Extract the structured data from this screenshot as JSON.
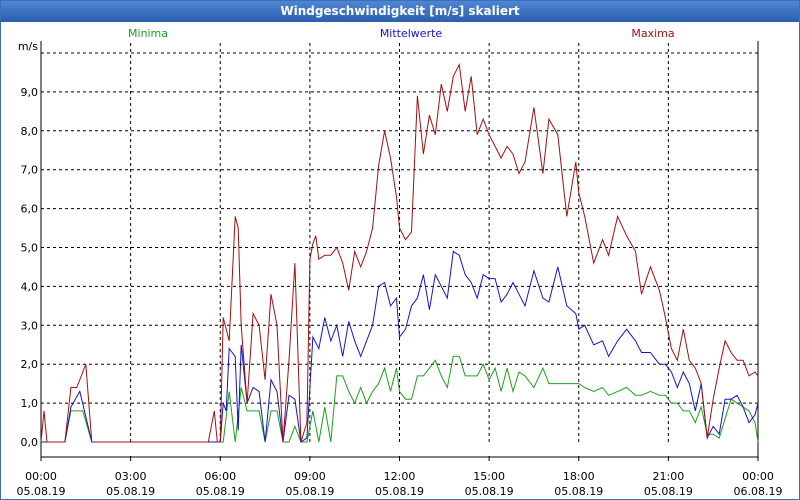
{
  "window_title": "Windgeschwindigkeit [m/s] skaliert",
  "colors": {
    "minima": "#1ca01c",
    "mittelwerte": "#1414c8",
    "maxima": "#a01010",
    "grid": "#000000"
  },
  "chart_data": {
    "type": "line",
    "title": "Windgeschwindigkeit [m/s] skaliert",
    "ylabel": "m/s",
    "ylim": [
      0,
      10
    ],
    "xlim_hours": [
      0,
      24
    ],
    "grid": true,
    "y_ticks": [
      "0,0",
      "1,0",
      "2,0",
      "3,0",
      "4,0",
      "5,0",
      "6,0",
      "7,0",
      "8,0",
      "9,0"
    ],
    "x_ticks": [
      {
        "time": "00:00",
        "date": "05.08.19"
      },
      {
        "time": "03:00",
        "date": "05.08.19"
      },
      {
        "time": "06:00",
        "date": "05.08.19"
      },
      {
        "time": "09:00",
        "date": "05.08.19"
      },
      {
        "time": "12:00",
        "date": "05.08.19"
      },
      {
        "time": "15:00",
        "date": "05.08.19"
      },
      {
        "time": "18:00",
        "date": "05.08.19"
      },
      {
        "time": "21:00",
        "date": "05.08.19"
      },
      {
        "time": "00:00",
        "date": "06.08.19"
      }
    ],
    "series": [
      {
        "name": "Minima",
        "color": "#1ca01c",
        "points": [
          [
            0,
            0
          ],
          [
            0.2,
            0
          ],
          [
            0.8,
            0
          ],
          [
            1.0,
            0.8
          ],
          [
            1.4,
            0.8
          ],
          [
            1.7,
            0
          ],
          [
            6.0,
            0
          ],
          [
            6.1,
            0
          ],
          [
            6.3,
            1.3
          ],
          [
            6.5,
            0
          ],
          [
            6.7,
            1.4
          ],
          [
            6.9,
            0.8
          ],
          [
            7.1,
            0.8
          ],
          [
            7.3,
            0.8
          ],
          [
            7.5,
            0
          ],
          [
            7.7,
            0.8
          ],
          [
            7.9,
            0.8
          ],
          [
            8.1,
            0
          ],
          [
            8.3,
            0
          ],
          [
            8.5,
            0.4
          ],
          [
            8.7,
            0
          ],
          [
            8.9,
            0
          ],
          [
            9.1,
            0.8
          ],
          [
            9.3,
            0
          ],
          [
            9.5,
            0.9
          ],
          [
            9.7,
            0
          ],
          [
            9.9,
            1.7
          ],
          [
            10.1,
            1.7
          ],
          [
            10.3,
            1.3
          ],
          [
            10.5,
            1.0
          ],
          [
            10.7,
            1.4
          ],
          [
            10.9,
            1.0
          ],
          [
            11.1,
            1.3
          ],
          [
            11.3,
            1.5
          ],
          [
            11.5,
            1.9
          ],
          [
            11.7,
            1.3
          ],
          [
            11.9,
            1.9
          ],
          [
            12.0,
            1.3
          ],
          [
            12.2,
            1.1
          ],
          [
            12.4,
            1.1
          ],
          [
            12.6,
            1.7
          ],
          [
            12.8,
            1.7
          ],
          [
            13.0,
            1.9
          ],
          [
            13.2,
            2.1
          ],
          [
            13.4,
            1.7
          ],
          [
            13.6,
            1.4
          ],
          [
            13.8,
            2.2
          ],
          [
            14.0,
            2.2
          ],
          [
            14.2,
            1.7
          ],
          [
            14.4,
            1.7
          ],
          [
            14.6,
            1.7
          ],
          [
            14.8,
            2.0
          ],
          [
            15.0,
            1.6
          ],
          [
            15.2,
            1.9
          ],
          [
            15.4,
            1.3
          ],
          [
            15.6,
            1.9
          ],
          [
            15.8,
            1.3
          ],
          [
            16.0,
            1.8
          ],
          [
            16.2,
            1.7
          ],
          [
            16.5,
            1.4
          ],
          [
            16.8,
            1.9
          ],
          [
            17.0,
            1.5
          ],
          [
            17.3,
            1.5
          ],
          [
            17.6,
            1.5
          ],
          [
            17.9,
            1.5
          ],
          [
            18.0,
            1.5
          ],
          [
            18.2,
            1.4
          ],
          [
            18.5,
            1.3
          ],
          [
            18.8,
            1.4
          ],
          [
            19.0,
            1.2
          ],
          [
            19.3,
            1.3
          ],
          [
            19.6,
            1.4
          ],
          [
            19.9,
            1.2
          ],
          [
            20.1,
            1.2
          ],
          [
            20.4,
            1.3
          ],
          [
            20.7,
            1.2
          ],
          [
            20.9,
            1.2
          ],
          [
            21.1,
            1.0
          ],
          [
            21.3,
            1.0
          ],
          [
            21.5,
            0.8
          ],
          [
            21.7,
            0.8
          ],
          [
            21.9,
            0.5
          ],
          [
            22.1,
            0.9
          ],
          [
            22.3,
            0.2
          ],
          [
            22.5,
            0.2
          ],
          [
            22.7,
            0.1
          ],
          [
            22.9,
            0.6
          ],
          [
            23.1,
            1.1
          ],
          [
            23.3,
            1.0
          ],
          [
            23.5,
            0.9
          ],
          [
            23.7,
            0.8
          ],
          [
            23.9,
            0.5
          ],
          [
            24.0,
            0
          ]
        ]
      },
      {
        "name": "Mittelwerte",
        "color": "#1414c8",
        "points": [
          [
            0,
            0
          ],
          [
            0.2,
            0
          ],
          [
            0.8,
            0
          ],
          [
            1.0,
            0.9
          ],
          [
            1.3,
            1.3
          ],
          [
            1.7,
            0
          ],
          [
            6.0,
            0
          ],
          [
            6.1,
            1.0
          ],
          [
            6.2,
            0.8
          ],
          [
            6.3,
            2.4
          ],
          [
            6.5,
            2.2
          ],
          [
            6.6,
            0.3
          ],
          [
            6.7,
            2.5
          ],
          [
            6.9,
            1.0
          ],
          [
            7.1,
            1.4
          ],
          [
            7.3,
            1.3
          ],
          [
            7.5,
            0
          ],
          [
            7.7,
            1.6
          ],
          [
            7.9,
            1.3
          ],
          [
            8.1,
            0
          ],
          [
            8.3,
            1.2
          ],
          [
            8.5,
            1.1
          ],
          [
            8.7,
            0
          ],
          [
            8.9,
            0.1
          ],
          [
            9.1,
            2.7
          ],
          [
            9.3,
            2.4
          ],
          [
            9.5,
            3.2
          ],
          [
            9.7,
            2.6
          ],
          [
            9.9,
            3.0
          ],
          [
            10.1,
            2.2
          ],
          [
            10.3,
            3.1
          ],
          [
            10.5,
            2.6
          ],
          [
            10.7,
            2.2
          ],
          [
            10.9,
            2.6
          ],
          [
            11.1,
            3.0
          ],
          [
            11.3,
            4.0
          ],
          [
            11.5,
            4.1
          ],
          [
            11.7,
            3.5
          ],
          [
            11.9,
            3.7
          ],
          [
            12.0,
            2.7
          ],
          [
            12.2,
            2.9
          ],
          [
            12.4,
            3.5
          ],
          [
            12.6,
            3.7
          ],
          [
            12.8,
            4.3
          ],
          [
            13.0,
            3.4
          ],
          [
            13.2,
            4.3
          ],
          [
            13.4,
            4.0
          ],
          [
            13.6,
            3.7
          ],
          [
            13.8,
            4.9
          ],
          [
            14.0,
            4.8
          ],
          [
            14.2,
            4.3
          ],
          [
            14.4,
            4.1
          ],
          [
            14.6,
            3.7
          ],
          [
            14.8,
            4.3
          ],
          [
            15.0,
            4.2
          ],
          [
            15.2,
            4.2
          ],
          [
            15.4,
            3.6
          ],
          [
            15.6,
            3.8
          ],
          [
            15.8,
            4.1
          ],
          [
            16.0,
            3.8
          ],
          [
            16.2,
            3.5
          ],
          [
            16.5,
            4.4
          ],
          [
            16.8,
            3.7
          ],
          [
            17.0,
            3.6
          ],
          [
            17.3,
            4.5
          ],
          [
            17.6,
            3.5
          ],
          [
            17.9,
            3.3
          ],
          [
            18.0,
            2.9
          ],
          [
            18.2,
            3.0
          ],
          [
            18.5,
            2.5
          ],
          [
            18.8,
            2.6
          ],
          [
            19.0,
            2.2
          ],
          [
            19.3,
            2.6
          ],
          [
            19.6,
            2.9
          ],
          [
            19.9,
            2.6
          ],
          [
            20.1,
            2.3
          ],
          [
            20.4,
            2.3
          ],
          [
            20.7,
            2.0
          ],
          [
            20.9,
            2.0
          ],
          [
            21.1,
            1.8
          ],
          [
            21.3,
            1.4
          ],
          [
            21.5,
            1.8
          ],
          [
            21.7,
            1.5
          ],
          [
            21.9,
            0.8
          ],
          [
            22.1,
            1.5
          ],
          [
            22.3,
            0.1
          ],
          [
            22.5,
            0.4
          ],
          [
            22.7,
            0.2
          ],
          [
            22.9,
            1.1
          ],
          [
            23.1,
            1.1
          ],
          [
            23.3,
            1.2
          ],
          [
            23.5,
            0.9
          ],
          [
            23.7,
            0.5
          ],
          [
            23.9,
            0.7
          ],
          [
            24.0,
            1.0
          ]
        ]
      },
      {
        "name": "Maxima",
        "color": "#a01010",
        "points": [
          [
            0,
            0
          ],
          [
            0.1,
            0.8
          ],
          [
            0.2,
            0
          ],
          [
            0.8,
            0
          ],
          [
            1.0,
            1.4
          ],
          [
            1.2,
            1.4
          ],
          [
            1.4,
            1.8
          ],
          [
            1.5,
            2.0
          ],
          [
            1.7,
            0
          ],
          [
            5.6,
            0
          ],
          [
            5.8,
            0.8
          ],
          [
            5.9,
            0
          ],
          [
            6.0,
            0
          ],
          [
            6.1,
            3.2
          ],
          [
            6.3,
            2.6
          ],
          [
            6.5,
            5.8
          ],
          [
            6.6,
            5.5
          ],
          [
            6.7,
            3.0
          ],
          [
            6.9,
            1.0
          ],
          [
            7.1,
            3.3
          ],
          [
            7.3,
            3.0
          ],
          [
            7.5,
            1.6
          ],
          [
            7.7,
            3.8
          ],
          [
            7.9,
            3.0
          ],
          [
            8.1,
            0
          ],
          [
            8.3,
            2.1
          ],
          [
            8.5,
            4.6
          ],
          [
            8.7,
            0
          ],
          [
            8.9,
            0.5
          ],
          [
            9.0,
            4.7
          ],
          [
            9.1,
            5.1
          ],
          [
            9.2,
            5.3
          ],
          [
            9.3,
            4.7
          ],
          [
            9.5,
            4.8
          ],
          [
            9.7,
            4.8
          ],
          [
            9.9,
            5.0
          ],
          [
            10.1,
            4.6
          ],
          [
            10.3,
            3.9
          ],
          [
            10.5,
            4.9
          ],
          [
            10.7,
            4.5
          ],
          [
            10.9,
            4.9
          ],
          [
            11.1,
            5.5
          ],
          [
            11.3,
            7.1
          ],
          [
            11.5,
            8.0
          ],
          [
            11.7,
            7.3
          ],
          [
            11.9,
            6.3
          ],
          [
            12.0,
            5.5
          ],
          [
            12.2,
            5.2
          ],
          [
            12.4,
            5.4
          ],
          [
            12.6,
            8.9
          ],
          [
            12.8,
            7.4
          ],
          [
            13.0,
            8.4
          ],
          [
            13.2,
            7.9
          ],
          [
            13.4,
            9.2
          ],
          [
            13.6,
            8.5
          ],
          [
            13.8,
            9.4
          ],
          [
            14.0,
            9.7
          ],
          [
            14.2,
            8.5
          ],
          [
            14.4,
            9.4
          ],
          [
            14.6,
            7.9
          ],
          [
            14.8,
            8.3
          ],
          [
            15.0,
            7.9
          ],
          [
            15.2,
            7.6
          ],
          [
            15.4,
            7.3
          ],
          [
            15.6,
            7.6
          ],
          [
            15.8,
            7.4
          ],
          [
            16.0,
            6.9
          ],
          [
            16.2,
            7.2
          ],
          [
            16.5,
            8.6
          ],
          [
            16.8,
            6.9
          ],
          [
            17.0,
            8.3
          ],
          [
            17.3,
            7.9
          ],
          [
            17.6,
            5.8
          ],
          [
            17.9,
            7.2
          ],
          [
            18.0,
            6.4
          ],
          [
            18.2,
            5.8
          ],
          [
            18.5,
            4.6
          ],
          [
            18.8,
            5.2
          ],
          [
            19.0,
            4.8
          ],
          [
            19.3,
            5.8
          ],
          [
            19.6,
            5.3
          ],
          [
            19.9,
            4.9
          ],
          [
            20.1,
            3.8
          ],
          [
            20.4,
            4.5
          ],
          [
            20.7,
            3.9
          ],
          [
            20.9,
            3.2
          ],
          [
            21.1,
            2.4
          ],
          [
            21.3,
            2.1
          ],
          [
            21.5,
            2.9
          ],
          [
            21.7,
            2.1
          ],
          [
            21.9,
            1.9
          ],
          [
            22.1,
            1.5
          ],
          [
            22.3,
            0.1
          ],
          [
            22.5,
            1.1
          ],
          [
            22.7,
            1.9
          ],
          [
            22.9,
            2.6
          ],
          [
            23.1,
            2.3
          ],
          [
            23.3,
            2.1
          ],
          [
            23.5,
            2.1
          ],
          [
            23.7,
            1.7
          ],
          [
            23.9,
            1.8
          ],
          [
            24.0,
            1.7
          ]
        ]
      }
    ]
  }
}
